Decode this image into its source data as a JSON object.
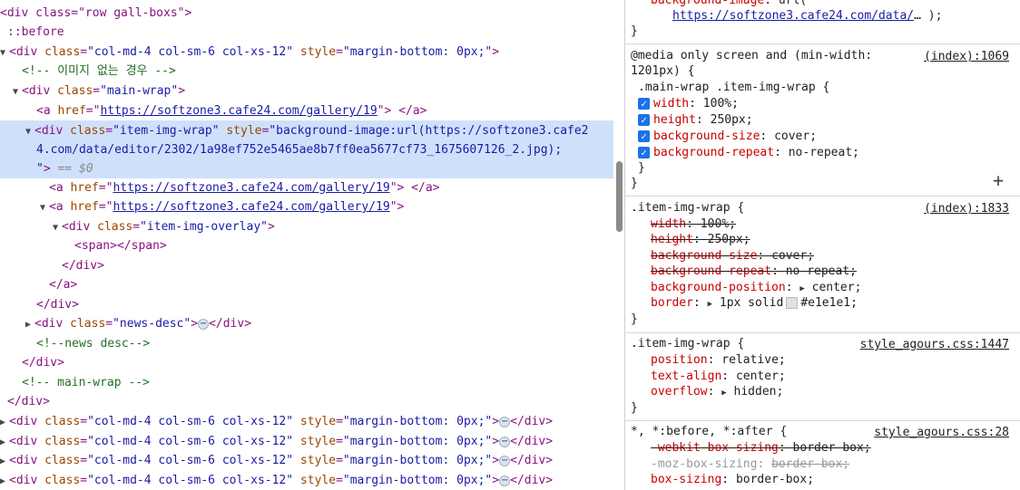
{
  "elements": {
    "l0_open": "<div class=\"row gall-boxs\">",
    "before": "::before",
    "col_open_tag": "div",
    "col_class_attr": "class",
    "col_class_val": "\"col-md-4 col-sm-6 col-xs-12\"",
    "col_style_attr": "style",
    "col_style_val": "\"margin-bottom: 0px;\"",
    "comment_noimg": "<!-- 이미지 없는 경우 -->",
    "mainwrap_tag": "div",
    "mainwrap_class": "\"main-wrap\"",
    "a_tag": "a",
    "a_href_attr": "href",
    "gallery_url": "https://softzone3.cafe24.com/gallery/19",
    "imgwrap_class": "\"item-img-wrap\"",
    "imgwrap_style_1": "\"background-image:url(https://softzone3.cafe2",
    "imgwrap_style_2": "4.com/data/editor/2302/1a98ef752e5465ae8b7ff0ea5677cf73_1675607126_2.jpg);",
    "imgwrap_style_3": "\"",
    "selected_marker": "== $0",
    "overlay_class": "\"item-img-overlay\"",
    "span_line": "<span></span>",
    "close_div": "</div>",
    "close_a": "</a>",
    "newsdesc_class": "\"news-desc\"",
    "comment_newsdesc": "<!--news desc-->",
    "comment_mainwrap": "<!-- main-wrap -->",
    "ellipsis": "⋯"
  },
  "styles": {
    "bg_image_prop": "background-image",
    "bg_image_open": "url(",
    "bg_image_url": "https://softzone3.cafe24.com/data/",
    "bg_image_tail": "… );",
    "close_brace": "}",
    "media_1": "@media only screen and (min-width:",
    "media_2": "1201px) {",
    "media_src": "(index):1069",
    "media_selector": ".main-wrap .item-img-wrap {",
    "width_prop": "width",
    "width_val": "100%;",
    "height_prop": "height",
    "height_val": "250px;",
    "bgsize_prop": "background-size",
    "bgsize_val": "cover;",
    "bgrepeat_prop": "background-repeat",
    "bgrepeat_val": "no-repeat;",
    "rule2_selector": ".item-img-wrap {",
    "rule2_src": "(index):1833",
    "bgpos_prop": "background-position",
    "bgpos_val": "center;",
    "border_prop": "border",
    "border_val_1": "1px solid",
    "border_val_2": "#e1e1e1;",
    "rule3_selector": ".item-img-wrap {",
    "rule3_src": "style_agours.css:1447",
    "position_prop": "position",
    "position_val": "relative;",
    "textalign_prop": "text-align",
    "textalign_val": "center;",
    "overflow_prop": "overflow",
    "overflow_val": "hidden;",
    "rule4_selector": "*, *:before, *:after {",
    "rule4_src": "style_agours.css:28",
    "webkit_prop": "-webkit-box-sizing",
    "webkit_val": "border-box;",
    "moz_prop": "-moz-box-sizing",
    "moz_val": "border-box;",
    "boxsizing_prop": "box-sizing",
    "boxsizing_val": "border-box;",
    "colon": ":",
    "plus": "+"
  }
}
